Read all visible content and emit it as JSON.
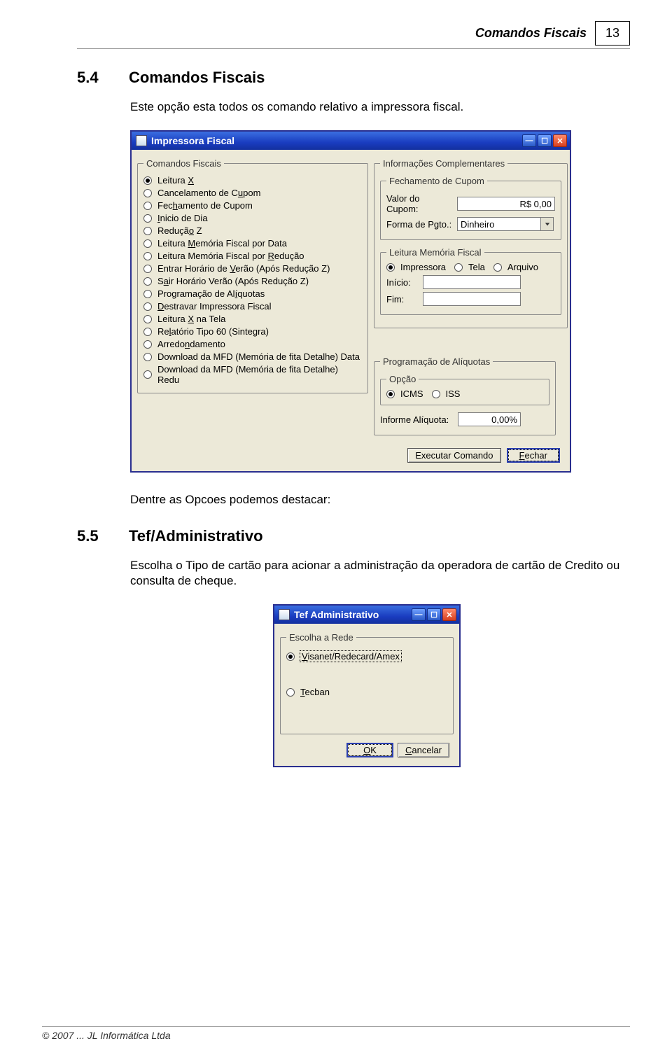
{
  "header": {
    "title": "Comandos Fiscais",
    "page_number": "13"
  },
  "section54": {
    "num": "5.4",
    "title": "Comandos Fiscais",
    "intro": "Este opção esta todos os comando relativo a impressora fiscal.",
    "after": "Dentre as Opcoes podemos destacar:"
  },
  "section55": {
    "num": "5.5",
    "title": "Tef/Administrativo",
    "intro": "Escolha o Tipo de cartão para acionar a administração da operadora de cartão de Credito ou consulta de cheque."
  },
  "window1": {
    "title": "Impressora Fiscal",
    "group_left_legend": "Comandos Fiscais",
    "radios": [
      {
        "pre": "Leitura ",
        "u": "X",
        "post": "",
        "checked": true
      },
      {
        "pre": "Cancelamento de C",
        "u": "u",
        "post": "pom",
        "checked": false
      },
      {
        "pre": "Fec",
        "u": "h",
        "post": "amento de Cupom",
        "checked": false
      },
      {
        "pre": "",
        "u": "I",
        "post": "nicio de Dia",
        "checked": false
      },
      {
        "pre": "Reduçã",
        "u": "o",
        "post": " Z",
        "checked": false
      },
      {
        "pre": "Leitura  ",
        "u": "M",
        "post": "emória Fiscal por Data",
        "checked": false
      },
      {
        "pre": "Leitura Memória Fiscal por ",
        "u": "R",
        "post": "edução",
        "checked": false
      },
      {
        "pre": "Entrar Horário de ",
        "u": "V",
        "post": "erão (Após Redução Z)",
        "checked": false
      },
      {
        "pre": "S",
        "u": "a",
        "post": "ir Horário Verão (Após Redução Z)",
        "checked": false
      },
      {
        "pre": "Programação de Al",
        "u": "í",
        "post": "quotas",
        "checked": false
      },
      {
        "pre": "",
        "u": "D",
        "post": "estravar Impressora Fiscal",
        "checked": false
      },
      {
        "pre": "Leitura ",
        "u": "X",
        "post": " na Tela",
        "checked": false
      },
      {
        "pre": "Re",
        "u": "l",
        "post": "atório Tipo 60 (Sintegra)",
        "checked": false
      },
      {
        "pre": "Arredo",
        "u": "n",
        "post": "damento",
        "checked": false
      },
      {
        "pre": "Download da MFD (Memória de fita Detalhe) Data",
        "u": "",
        "post": "",
        "checked": false
      },
      {
        "pre": "Download da MFD (Memória de fita Detalhe) Redu",
        "u": "",
        "post": "",
        "checked": false
      }
    ],
    "right": {
      "legend_comp": "Informações Complementares",
      "legend_fech": "Fechamento de Cupom",
      "valor_label": "Valor do Cupom:",
      "valor_value": "R$ 0,00",
      "forma_label": "Forma de Pgto.:",
      "forma_value": "Dinheiro",
      "legend_lmf": "Leitura Memória Fiscal",
      "lmf_radios": [
        {
          "label": "Impressora",
          "checked": true
        },
        {
          "label": "Tela",
          "checked": false
        },
        {
          "label": "Arquivo",
          "checked": false
        }
      ],
      "inicio_label": "Início:",
      "fim_label": "Fim:",
      "legend_prog": "Programação de Alíquotas",
      "legend_opcao": "Opção",
      "opcao_radios": [
        {
          "label": "ICMS",
          "checked": true
        },
        {
          "label": "ISS",
          "checked": false
        }
      ],
      "informe_label": "Informe Alíquota:",
      "informe_value": "0,00%"
    },
    "buttons": {
      "exec": "Executar Comando",
      "fechar_pre": "",
      "fechar_u": "F",
      "fechar_post": "echar"
    }
  },
  "window2": {
    "title": "Tef Administrativo",
    "legend": "Escolha a Rede",
    "radios": [
      {
        "pre": "",
        "u": "V",
        "post": "isanet/Redecard/Amex",
        "checked": true
      },
      {
        "pre": "",
        "u": "T",
        "post": "ecban",
        "checked": false
      }
    ],
    "buttons": {
      "ok_u": "O",
      "ok_post": "K",
      "cancel_u": "C",
      "cancel_post": "ancelar"
    }
  },
  "footer": "© 2007 ... JL Informática Ltda"
}
